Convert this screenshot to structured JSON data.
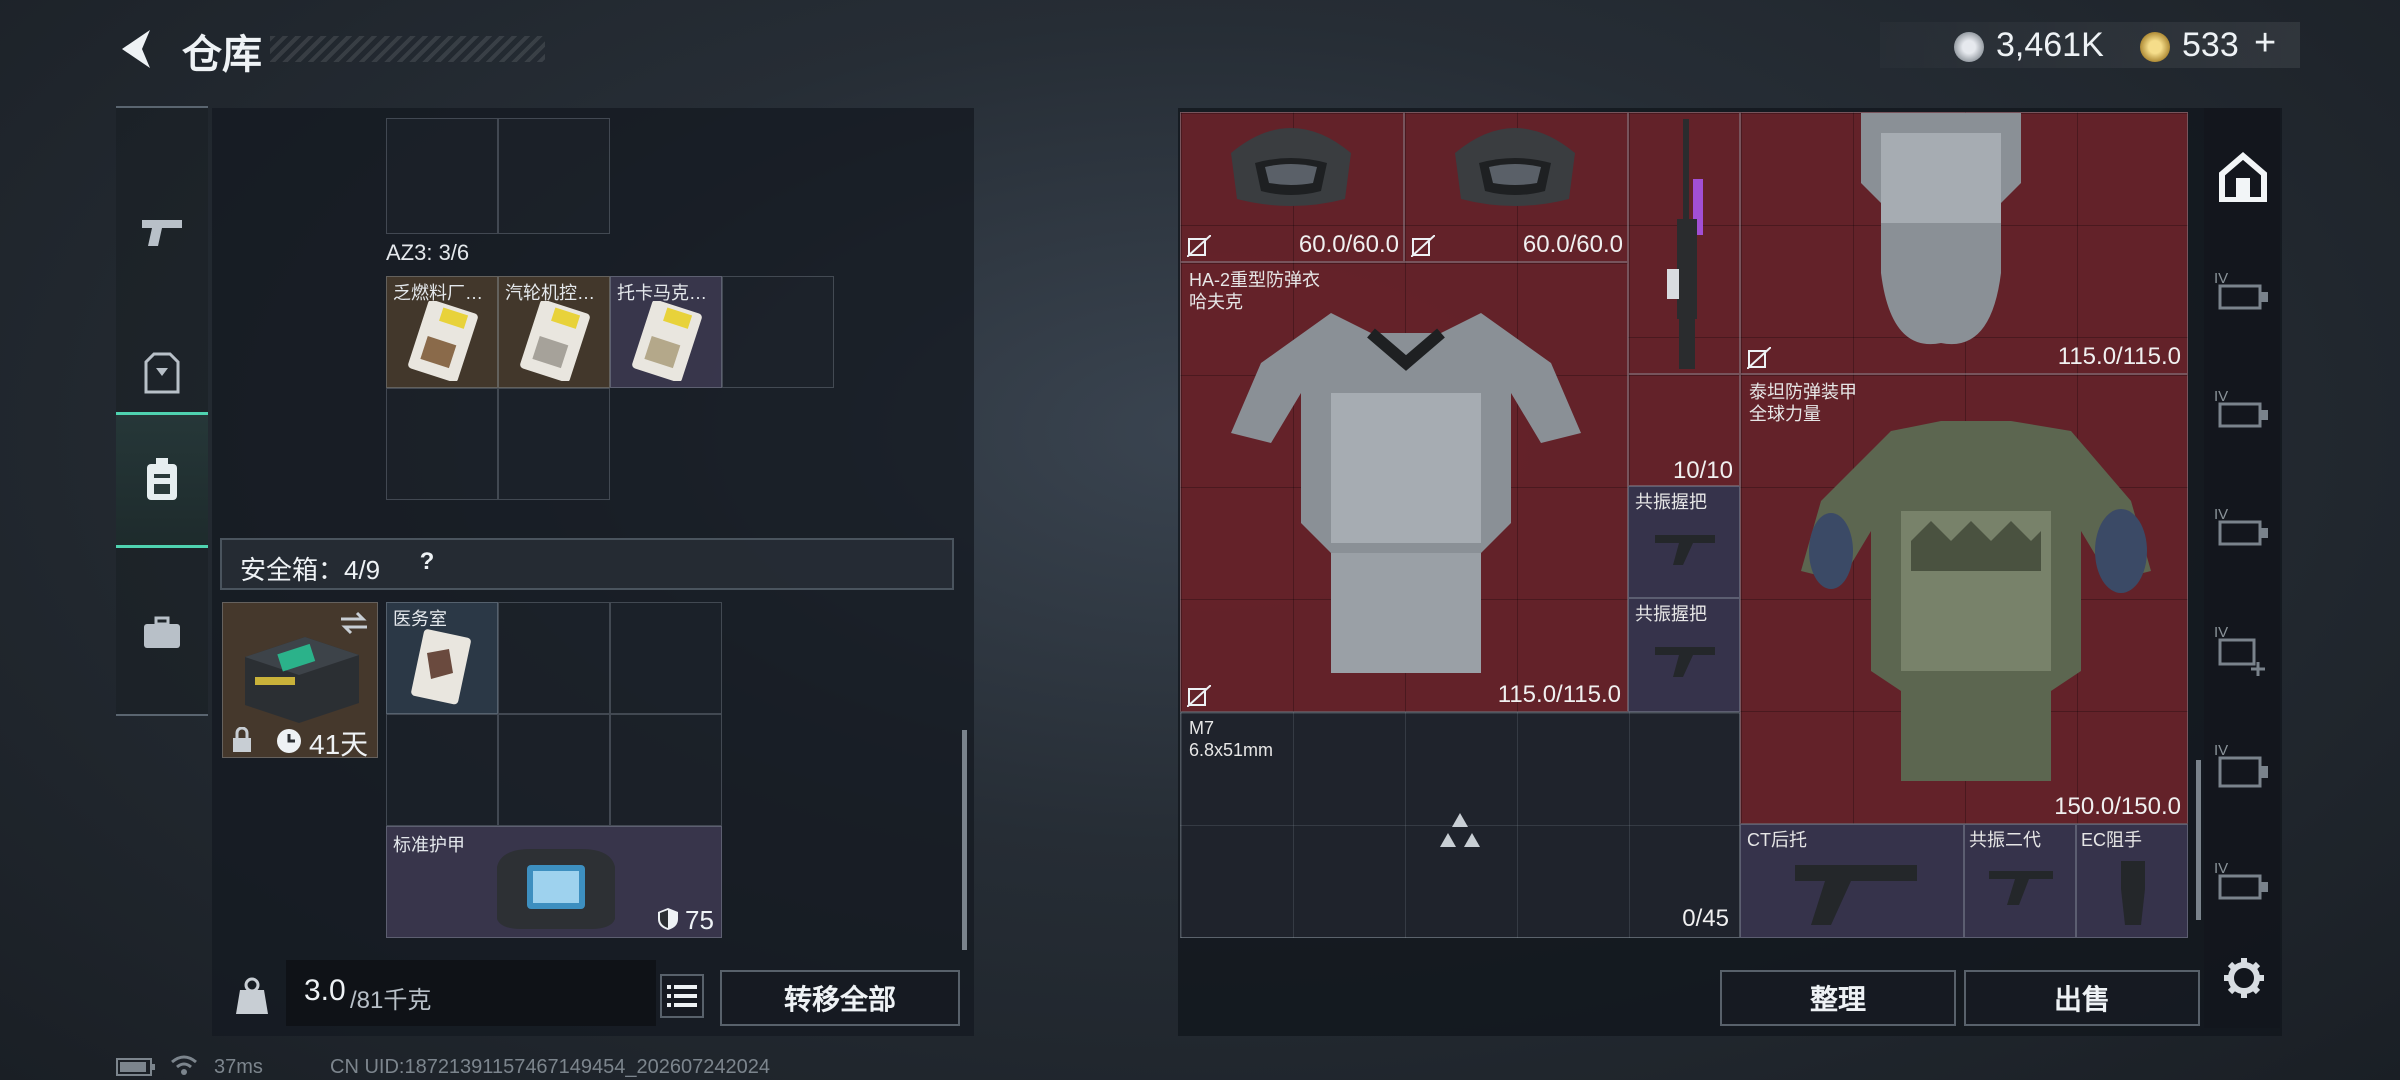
{
  "header": {
    "title": "仓库",
    "currency_silver": "3,461K",
    "currency_gold": "533",
    "currency_plus": "+"
  },
  "left": {
    "az3_label": "AZ3: 3/6",
    "az3_items": [
      "乏燃料厂…",
      "汽轮机控…",
      "托卡马克…"
    ],
    "safebox_label": "安全箱：4/9",
    "safebox_help": "?",
    "safebox_days": "41天",
    "safebox_items": {
      "medical": "医务室",
      "armor_bag": "标准护甲",
      "armor_value": "75"
    },
    "weight_current": "3.0",
    "weight_max": "/81千克",
    "transfer_all": "转移全部"
  },
  "right": {
    "helmet1_dur": "60.0/60.0",
    "helmet2_dur": "60.0/60.0",
    "armor1_name": "HA-2重型防弹衣",
    "armor1_brand": "哈夫克",
    "armor1_dur": "115.0/115.0",
    "weapon_count": "10/10",
    "grip1": "共振握把",
    "grip2": "共振握把",
    "vest_top_dur": "115.0/115.0",
    "armor2_name": "泰坦防弹装甲",
    "armor2_brand": "全球力量",
    "armor2_dur": "150.0/150.0",
    "ammo_name": "M7",
    "ammo_caliber": "6.8x51mm",
    "ammo_count": "0/45",
    "stock": "CT后托",
    "grip3": "共振二代",
    "ec": "EC阻手",
    "sort_button": "整理",
    "sell_button": "出售"
  },
  "side_rail": {
    "tags": [
      "IV",
      "IV",
      "IV",
      "IV",
      "IV",
      "IV"
    ]
  },
  "footer": {
    "ping": "37ms",
    "uid": "CN UID:18721391157467149454_202607242024"
  },
  "colors": {
    "accent": "#4fd3b0",
    "red_item_bg": "#6e232a",
    "purple_item_bg": "#3a3650"
  }
}
